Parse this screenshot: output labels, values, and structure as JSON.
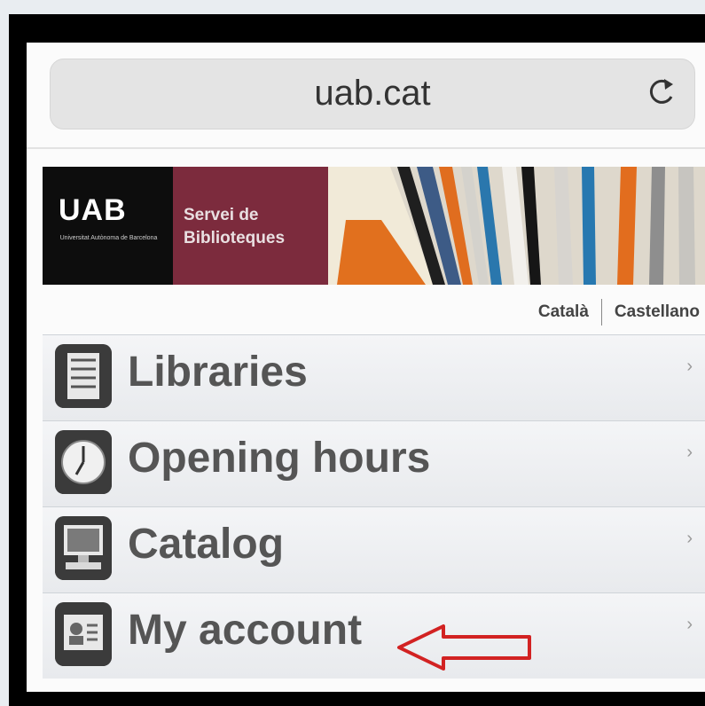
{
  "browser": {
    "url": "uab.cat"
  },
  "banner": {
    "logo": "UAB",
    "logo_sub": "Universitat Autònoma de Barcelona",
    "service_line1": "Servei de",
    "service_line2": "Biblioteques"
  },
  "languages": [
    "Català",
    "Castellano"
  ],
  "menu": {
    "items": [
      {
        "label": "Libraries",
        "icon": "library-icon"
      },
      {
        "label": "Opening hours",
        "icon": "clock-icon"
      },
      {
        "label": "Catalog",
        "icon": "computer-icon"
      },
      {
        "label": "My account",
        "icon": "account-icon"
      }
    ]
  },
  "colors": {
    "brand_red": "#7c2b3d",
    "annotation_arrow": "#d22222"
  }
}
